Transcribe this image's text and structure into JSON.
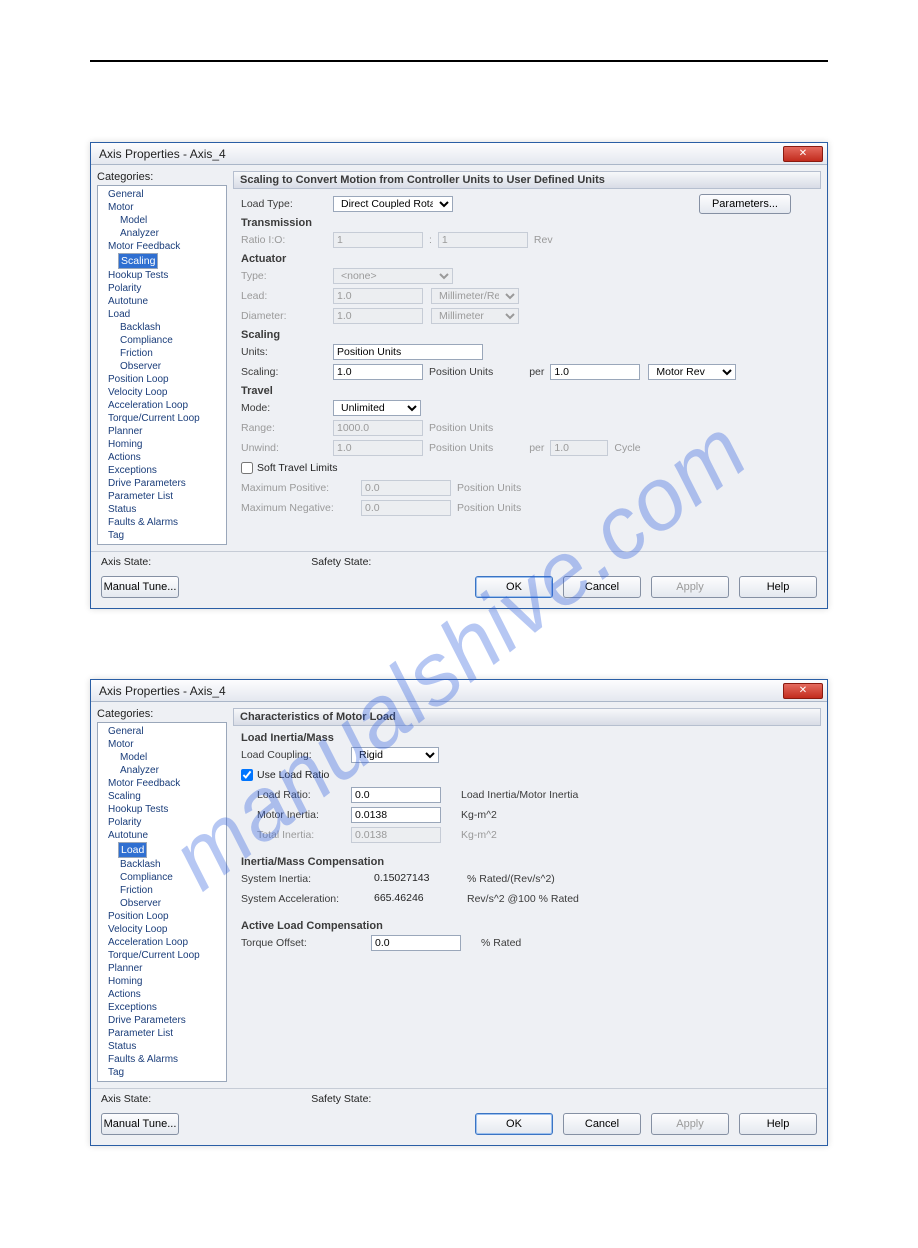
{
  "watermark": "manualshive.com",
  "header_links": {
    "a": "",
    "b": ""
  },
  "caption1": "",
  "caption2": "",
  "dialog": {
    "title": "Axis Properties - Axis_4",
    "categories_label": "Categories:",
    "status_axis": "Axis State:",
    "status_safety": "Safety State:",
    "buttons": {
      "manual_tune": "Manual Tune...",
      "ok": "OK",
      "cancel": "Cancel",
      "apply": "Apply",
      "help": "Help"
    }
  },
  "tree_common": [
    "General",
    "Motor",
    "Model",
    "Analyzer",
    "Motor Feedback",
    "Scaling",
    "Hookup Tests",
    "Polarity",
    "Autotune",
    "Load",
    "Backlash",
    "Compliance",
    "Friction",
    "Observer",
    "Position Loop",
    "Velocity Loop",
    "Acceleration Loop",
    "Torque/Current Loop",
    "Planner",
    "Homing",
    "Actions",
    "Exceptions",
    "Drive Parameters",
    "Parameter List",
    "Status",
    "Faults & Alarms",
    "Tag"
  ],
  "scaling": {
    "header": "Scaling to Convert Motion from Controller Units to User Defined Units",
    "load_type_label": "Load Type:",
    "load_type_value": "Direct Coupled Rotary",
    "parameters": "Parameters...",
    "transmission": "Transmission",
    "ratio_label": "Ratio I:O:",
    "ratio_a": "1",
    "ratio_b": "1",
    "ratio_unit": "Rev",
    "actuator": "Actuator",
    "type_label": "Type:",
    "type_value": "<none>",
    "lead_label": "Lead:",
    "lead_value": "1.0",
    "lead_unit": "Millimeter/Rev",
    "diameter_label": "Diameter:",
    "diameter_value": "1.0",
    "diameter_unit": "Millimeter",
    "scaling": "Scaling",
    "units_label": "Units:",
    "units_value": "Position Units",
    "scaling_label": "Scaling:",
    "scaling_value": "1.0",
    "scaling_unit": "Position Units",
    "per": "per",
    "per_value": "1.0",
    "per_unit": "Motor Rev",
    "travel": "Travel",
    "mode_label": "Mode:",
    "mode_value": "Unlimited",
    "range_label": "Range:",
    "range_value": "1000.0",
    "range_unit": "Position Units",
    "unwind_label": "Unwind:",
    "unwind_value": "1.0",
    "unwind_unit": "Position Units",
    "unwind_per": "per",
    "unwind_per_value": "1.0",
    "unwind_per_unit": "Cycle",
    "soft_limits": "Soft Travel Limits",
    "max_pos_label": "Maximum Positive:",
    "max_pos_value": "0.0",
    "max_pos_unit": "Position Units",
    "max_neg_label": "Maximum Negative:",
    "max_neg_value": "0.0",
    "max_neg_unit": "Position Units"
  },
  "load": {
    "header": "Characteristics of Motor Load",
    "inertia_mass": "Load Inertia/Mass",
    "coupling_label": "Load Coupling:",
    "coupling_value": "Rigid",
    "use_ratio": "Use Load Ratio",
    "ratio_label": "Load Ratio:",
    "ratio_value": "0.0",
    "ratio_unit": "Load Inertia/Motor Inertia",
    "motor_inertia_label": "Motor Inertia:",
    "motor_inertia_value": "0.0138",
    "motor_inertia_unit": "Kg-m^2",
    "total_inertia_label": "Total Inertia:",
    "total_inertia_value": "0.0138",
    "total_inertia_unit": "Kg-m^2",
    "comp": "Inertia/Mass Compensation",
    "sys_inertia_label": "System Inertia:",
    "sys_inertia_value": "0.15027143",
    "sys_inertia_unit": "% Rated/(Rev/s^2)",
    "sys_accel_label": "System Acceleration:",
    "sys_accel_value": "665.46246",
    "sys_accel_unit": "Rev/s^2 @100 % Rated",
    "active_comp": "Active Load Compensation",
    "torque_label": "Torque Offset:",
    "torque_value": "0.0",
    "torque_unit": "% Rated"
  }
}
